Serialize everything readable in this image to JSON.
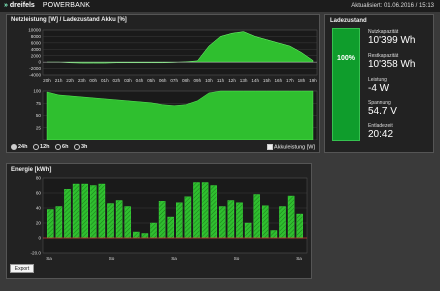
{
  "header": {
    "brand": "dreifels",
    "product": "POWERBANK",
    "updated": "Aktualisiert: 01.06.2016 / 15:13"
  },
  "power_panel": {
    "title": "Netzleistung [W] / Ladezustand Akku [%]",
    "y_ticks_top": [
      "10000",
      "8000",
      "6000",
      "4000",
      "2000",
      "0",
      "-2000",
      "-4000"
    ],
    "x_ticks": [
      "20h",
      "21h",
      "22h",
      "23h",
      "00h",
      "01h",
      "02h",
      "03h",
      "04h",
      "05h",
      "06h",
      "07h",
      "08h",
      "09h",
      "10h",
      "11h",
      "12h",
      "13h",
      "14h",
      "15h",
      "16h",
      "17h",
      "18h",
      "19h"
    ],
    "y_ticks_bottom": [
      "100",
      "75",
      "50",
      "25"
    ],
    "ranges": [
      {
        "label": "24h",
        "selected": true
      },
      {
        "label": "12h",
        "selected": false
      },
      {
        "label": "6h",
        "selected": false
      },
      {
        "label": "3h",
        "selected": false
      }
    ],
    "battery_power_label": "Akkuleistung [W]",
    "battery_power_checked": true
  },
  "charge_panel": {
    "title": "Ladezustand",
    "percent": "100%",
    "stats": [
      {
        "label": "Nutzkapazität",
        "value": "10'399 Wh"
      },
      {
        "label": "Restkapazität",
        "value": "10'358 Wh"
      },
      {
        "label": "Leistung",
        "value": "-4 W"
      },
      {
        "label": "Spannung",
        "value": "54.7 V"
      },
      {
        "label": "Entladezeit",
        "value": "20:42"
      }
    ]
  },
  "energy_panel": {
    "title": "Energie [kWh]",
    "y_ticks": [
      "80",
      "60",
      "40",
      "20",
      "0",
      "-20.0"
    ],
    "x_ticks": [
      "Sa",
      "So",
      "Sa",
      "So",
      "Sa"
    ],
    "export_label": "Export"
  },
  "colors": {
    "accent_green": "#2fbf2f",
    "battery_green": "#0f9d2c",
    "panel_bg": "#222222"
  },
  "chart_data": [
    {
      "type": "area",
      "title": "Netzleistung [W] / Ladezustand Akku [%]",
      "series": [
        {
          "x": [
            "20h",
            "21h",
            "22h",
            "23h",
            "00h",
            "01h",
            "02h",
            "03h",
            "04h",
            "05h",
            "06h",
            "07h",
            "08h",
            "09h",
            "10h",
            "11h",
            "12h",
            "13h",
            "14h",
            "15h",
            "16h",
            "17h",
            "18h",
            "19h"
          ],
          "values": [
            0,
            0,
            -200,
            -300,
            -300,
            -300,
            -200,
            -200,
            -200,
            -200,
            -200,
            -100,
            100,
            400,
            5000,
            8000,
            9000,
            9500,
            8000,
            7000,
            6000,
            5000,
            3000,
            500
          ]
        }
      ],
      "ylim": [
        -4000,
        10000
      ]
    },
    {
      "type": "area",
      "series": [
        {
          "x": [
            "20h",
            "21h",
            "22h",
            "23h",
            "00h",
            "01h",
            "02h",
            "03h",
            "04h",
            "05h",
            "06h",
            "07h",
            "08h",
            "09h",
            "10h",
            "11h",
            "12h",
            "13h",
            "14h",
            "15h",
            "16h",
            "17h",
            "18h",
            "19h"
          ],
          "values": [
            98,
            92,
            90,
            88,
            86,
            84,
            82,
            80,
            78,
            76,
            72,
            70,
            72,
            80,
            96,
            100,
            100,
            100,
            100,
            100,
            100,
            100,
            100,
            100
          ]
        }
      ],
      "ylim": [
        0,
        100
      ]
    },
    {
      "type": "bar",
      "title": "Energie [kWh]",
      "values": [
        38,
        42,
        65,
        72,
        72,
        70,
        72,
        46,
        50,
        42,
        8,
        6,
        20,
        49,
        28,
        47,
        55,
        74,
        74,
        70,
        42,
        50,
        47,
        20,
        58,
        43,
        10,
        42,
        56,
        32
      ],
      "ylim": [
        -20,
        80
      ]
    }
  ]
}
